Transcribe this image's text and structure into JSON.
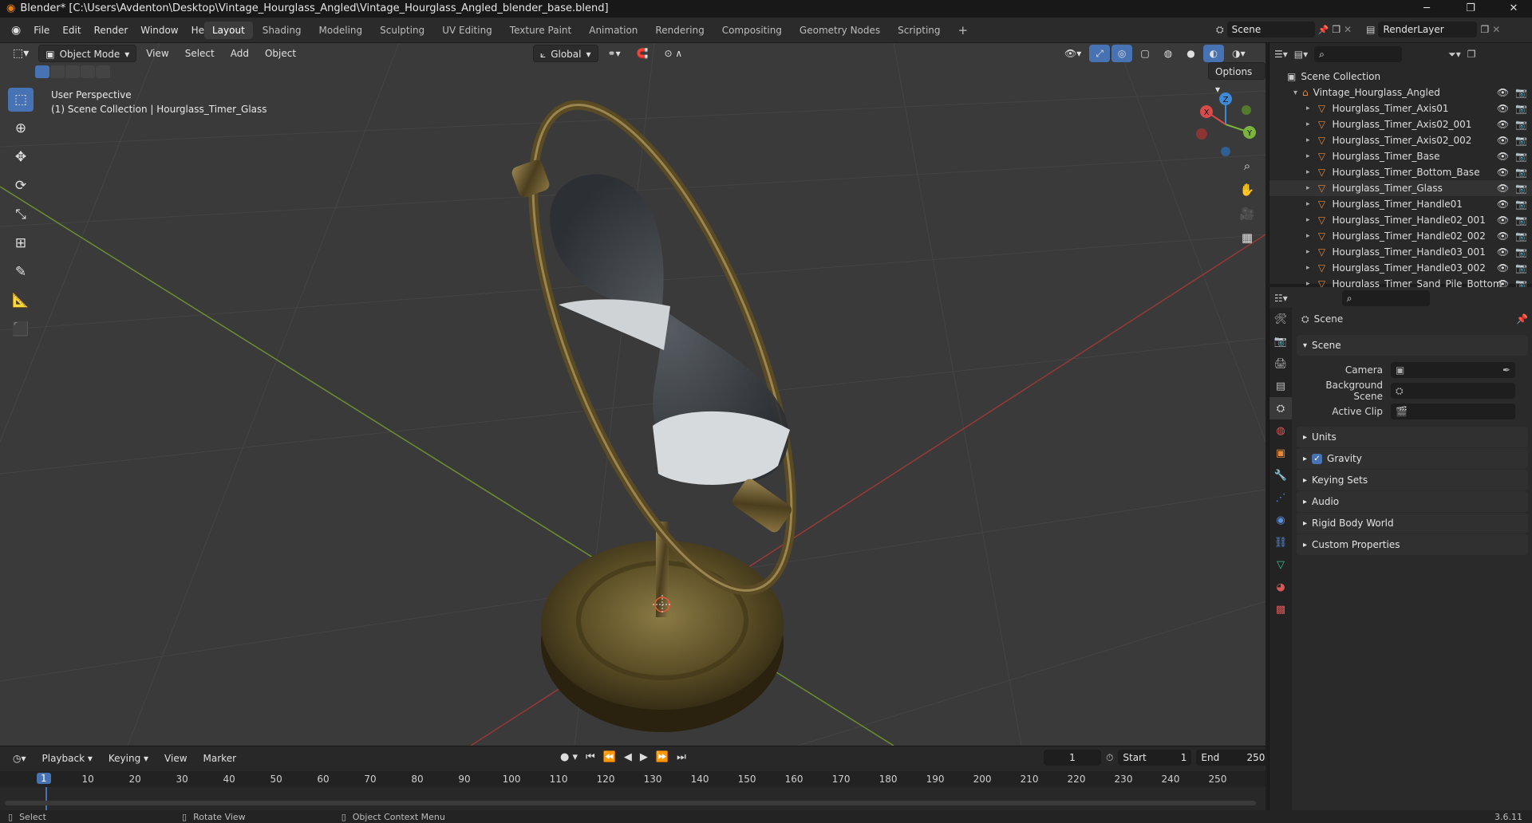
{
  "window": {
    "title": "Blender* [C:\\Users\\Avdenton\\Desktop\\Vintage_Hourglass_Angled\\Vintage_Hourglass_Angled_blender_base.blend]",
    "minimize": "─",
    "maximize": "❐",
    "close": "✕"
  },
  "menu": [
    "File",
    "Edit",
    "Render",
    "Window",
    "Help"
  ],
  "workspaces": {
    "active": "Layout",
    "tabs": [
      "Layout",
      "Shading",
      "Modeling",
      "Sculpting",
      "UV Editing",
      "Texture Paint",
      "Animation",
      "Rendering",
      "Compositing",
      "Geometry Nodes",
      "Scripting"
    ],
    "add": "+"
  },
  "scene_selector": {
    "value": "Scene"
  },
  "view_layer_selector": {
    "value": "RenderLayer"
  },
  "viewport_header": {
    "mode": "Object Mode",
    "menus": [
      "View",
      "Select",
      "Add",
      "Object"
    ],
    "transform_orientation": "Global",
    "options": "Options"
  },
  "viewport_overlay": {
    "line1": "User Perspective",
    "line2": "(1) Scene Collection | Hourglass_Timer_Glass"
  },
  "nav_gizmo": {
    "x": "X",
    "y": "Y",
    "z": "Z"
  },
  "outliner": {
    "root": "Scene Collection",
    "collection": "Vintage_Hourglass_Angled",
    "items": [
      "Hourglass_Timer_Axis01",
      "Hourglass_Timer_Axis02_001",
      "Hourglass_Timer_Axis02_002",
      "Hourglass_Timer_Base",
      "Hourglass_Timer_Bottom_Base",
      "Hourglass_Timer_Glass",
      "Hourglass_Timer_Handle01",
      "Hourglass_Timer_Handle02_001",
      "Hourglass_Timer_Handle02_002",
      "Hourglass_Timer_Handle03_001",
      "Hourglass_Timer_Handle03_002",
      "Hourglass_Timer_Sand_Pile_Bottom"
    ]
  },
  "properties": {
    "breadcrumb": "Scene",
    "scene_panel": "Scene",
    "fields": [
      {
        "label": "Camera",
        "value": ""
      },
      {
        "label": "Background Scene",
        "value": ""
      },
      {
        "label": "Active Clip",
        "value": ""
      }
    ],
    "panels": [
      "Units",
      "Gravity",
      "Keying Sets",
      "Audio",
      "Rigid Body World",
      "Custom Properties"
    ],
    "gravity_checked": true
  },
  "timeline": {
    "menus": [
      "Playback",
      "Keying",
      "View",
      "Marker"
    ],
    "current_frame": "1",
    "start_label": "Start",
    "start": "1",
    "end_label": "End",
    "end": "250",
    "ticks": [
      "10",
      "20",
      "30",
      "40",
      "50",
      "60",
      "70",
      "80",
      "90",
      "100",
      "110",
      "120",
      "130",
      "140",
      "150",
      "160",
      "170",
      "180",
      "190",
      "200",
      "210",
      "220",
      "230",
      "240",
      "250"
    ],
    "playhead": "1"
  },
  "status_bar": {
    "items": [
      "Select",
      "Rotate View",
      "Object Context Menu"
    ],
    "version": "3.6.11"
  },
  "colors": {
    "accent": "#4772b3",
    "object_icon": "#e7893a",
    "x_axis": "#d94a4a",
    "y_axis": "#7ab33d",
    "z_axis": "#3d8ad9"
  }
}
